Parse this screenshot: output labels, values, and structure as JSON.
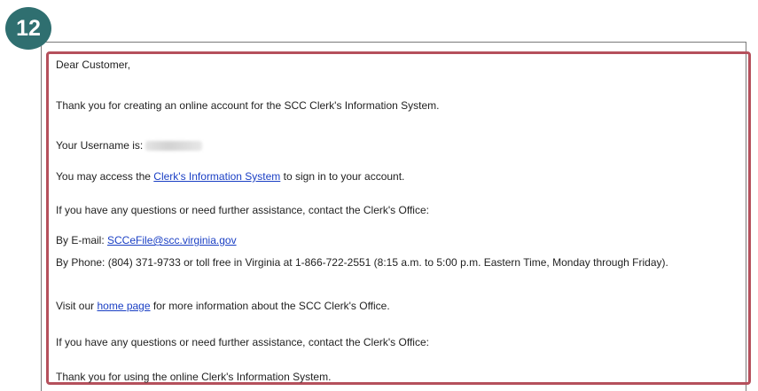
{
  "step": {
    "number": "12"
  },
  "email": {
    "greeting": "Dear Customer,",
    "thanks_creating": "Thank you for creating an online account for the SCC Clerk's Information System.",
    "username_label": "Your Username is:",
    "username_value": "",
    "access_prefix": "You may access the ",
    "access_link": "Clerk's Information System",
    "access_suffix": " to sign in to your account.",
    "questions_1": "If you have any questions or need further assistance, contact the Clerk's Office:",
    "email_label": "By E-mail: ",
    "email_link": "SCCeFile@scc.virginia.gov",
    "phone_line": "By Phone: (804) 371-9733 or toll free in Virginia at 1-866-722-2551 (8:15 a.m. to 5:00 p.m. Eastern Time, Monday through Friday).",
    "visit_prefix": "Visit our ",
    "visit_link": "home page",
    "visit_suffix": " for more information about the SCC Clerk's Office.",
    "questions_2": "If you have any questions or need further assistance, contact the Clerk's Office:",
    "closing": "Thank you for using the online Clerk's Information System."
  },
  "colors": {
    "badge": "#2f6f70",
    "highlight": "#b5505c",
    "link": "#1a3fc4"
  }
}
